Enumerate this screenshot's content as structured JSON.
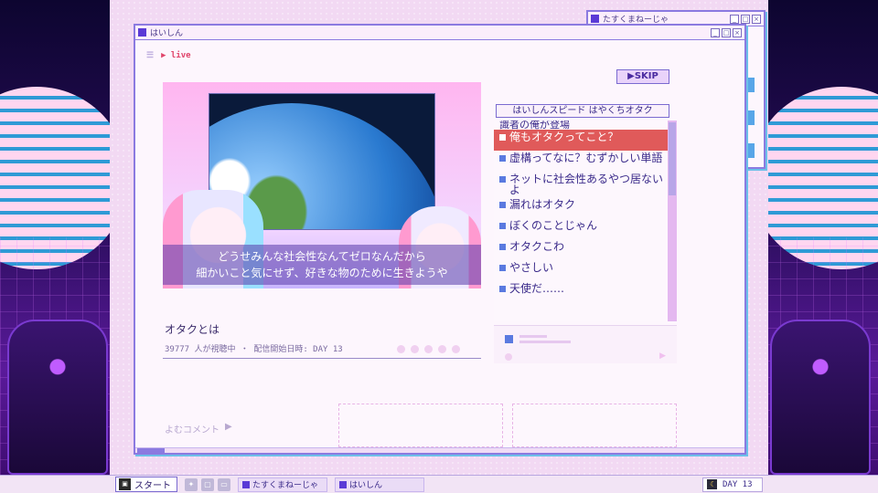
{
  "back_window": {
    "title": "たすくまねーじゃ"
  },
  "main_window": {
    "title": "はいしん",
    "live_label": "▶ live",
    "skip_label": "▶SKIP",
    "stream": {
      "subtitle_line1": "どうせみんな社会性なんてゼロなんだから",
      "subtitle_line2": "細かいこと気にせず、好きな物のために生きようや",
      "title": "オタクとは",
      "meta": "39777 人が視聴中 ・ 配信開始日時: DAY 13"
    },
    "speed_label": "はいしんスピード はやくちオタク",
    "comments": {
      "partial_top": "識者の俺が登場",
      "items": [
        {
          "text": "俺もオタクってこと？",
          "highlight": true
        },
        {
          "text": "虚構ってなに？むずかしい単語",
          "highlight": false
        },
        {
          "text": "ネットに社会性あるやつ居ないよ",
          "highlight": false
        },
        {
          "text": "漏れはオタク",
          "highlight": false
        },
        {
          "text": "ぼくのことじゃん",
          "highlight": false
        },
        {
          "text": "オタクこわ",
          "highlight": false
        },
        {
          "text": "やさしい",
          "highlight": false
        },
        {
          "text": "天使だ……",
          "highlight": false
        }
      ]
    },
    "read_comments_label": "よむコメント"
  },
  "taskbar": {
    "start_label": "スタート",
    "tasks": [
      {
        "label": "たすくまねーじゃ"
      },
      {
        "label": "はいしん"
      }
    ],
    "day_label": "DAY 13"
  },
  "colors": {
    "accent": "#5a3ad6",
    "highlight": "#e05a5a",
    "border": "#8b7ae0"
  }
}
